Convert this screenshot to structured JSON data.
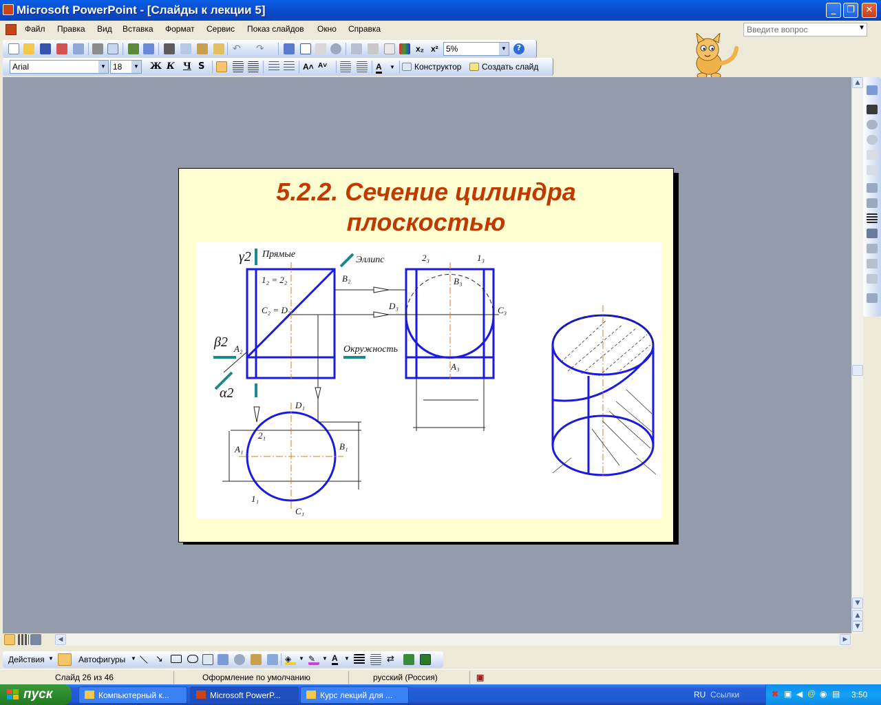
{
  "window": {
    "title": "Microsoft PowerPoint - [Слайды к лекции 5]"
  },
  "menu": [
    "Файл",
    "Правка",
    "Вид",
    "Вставка",
    "Формат",
    "Сервис",
    "Показ слайдов",
    "Окно",
    "Справка"
  ],
  "help_box": {
    "placeholder": "Введите вопрос"
  },
  "toolbar_standard": {
    "zoom": "5%"
  },
  "toolbar_format": {
    "font": "Arial",
    "size": "18",
    "bold": "Ж",
    "italic": "К",
    "underline": "Ч",
    "shadow": "S",
    "designer": "Конструктор",
    "new_slide": "Создать слайд"
  },
  "slide": {
    "title_line1": "5.2.2. Сечение цилиндра",
    "title_line2": "плоскостью",
    "labels": {
      "gamma": "γ2",
      "beta": "β2",
      "alpha": "α2",
      "lines": "Прямые",
      "ellipse": "Эллипс",
      "circle": "Окружность",
      "p12": "1₂ = 2₂",
      "cd2": "C₂ = D₂",
      "a2": "A₂",
      "b2": "B₂",
      "p23": "2₃",
      "p13": "1₃",
      "b3": "B₃",
      "d3": "D₃",
      "c3": "C₃",
      "a3": "A₃",
      "d1": "D₁",
      "p21": "2₁",
      "a1": "A₁",
      "b1": "B₁",
      "p11": "1₁",
      "c1": "C₁"
    }
  },
  "drawing_toolbar": {
    "actions": "Действия",
    "autoshapes": "Автофигуры"
  },
  "status": {
    "slide": "Слайд 26 из 46",
    "design": "Оформление по умолчанию",
    "language": "русский (Россия)"
  },
  "taskbar": {
    "start": "пуск",
    "tasks": [
      "Компьютерный к...",
      "Microsoft PowerP...",
      "Курс лекций для ..."
    ],
    "lang": "RU",
    "links": "Ссылки",
    "clock": "3:50"
  },
  "colors": {
    "accent": "#0a49c8",
    "slide_bg": "#ffffd2",
    "title": "#c03a00",
    "drawing": "#1a1ae0"
  }
}
